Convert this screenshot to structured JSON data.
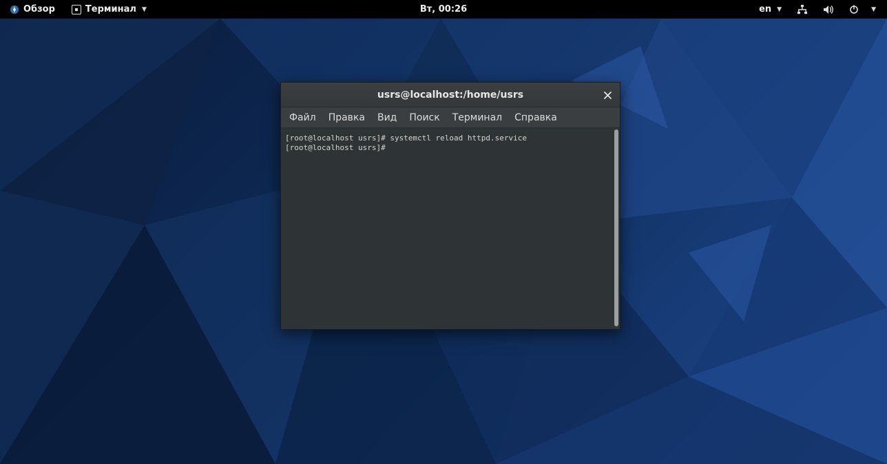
{
  "topbar": {
    "activities_label": "Обзор",
    "taskbar_app_label": "Терминал",
    "clock": "Вт, 00:26",
    "lang": "en"
  },
  "terminal": {
    "title": "usrs@localhost:/home/usrs",
    "menu": {
      "file": "Файл",
      "edit": "Правка",
      "view": "Вид",
      "search": "Поиск",
      "terminal": "Терминал",
      "help": "Справка"
    },
    "content": "[root@localhost usrs]# systemctl reload httpd.service\n[root@localhost usrs]# "
  }
}
